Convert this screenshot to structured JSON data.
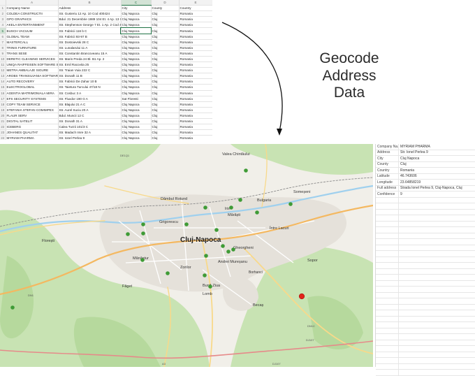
{
  "spreadsheet": {
    "column_letters": [
      "A",
      "B",
      "C",
      "D",
      "E"
    ],
    "headers": [
      "Company Name",
      "Address",
      "City",
      "County",
      "Country"
    ],
    "rows": [
      [
        "COLDEA CONSTRUCTII",
        "Str. Gusteriu 12 Ap. 10 Cod 400424",
        "Cluj Napoca",
        "Cluj",
        "Romania"
      ],
      [
        "GPO GRAPHICS",
        "Bdul. 21 Decembrie 1989 104 Et. 4 Ap. 13 Cod 400124",
        "Cluj Napoca",
        "Cluj",
        "Romania"
      ],
      [
        "AKELA ENTERTAINMENT",
        "Str. Stephenson George 7 Et. 1 Ap. 2 Cod 400287",
        "Cluj Napoca",
        "Cluj",
        "Romania"
      ],
      [
        "BUSCH VACUUM",
        "Str. Fabricii 116 b C",
        "Cluj Napoca",
        "Cluj",
        "Romania"
      ],
      [
        "GLOBAL TEAM",
        "Str. Fabricii 93-97 B",
        "Cluj Napoca",
        "Cluj",
        "Romania"
      ],
      [
        "MASTERCALL",
        "Str. Dostoievski 28 C",
        "Cluj Napoca",
        "Cluj",
        "Romania"
      ],
      [
        "TRINIS FURNITURE",
        "Str. Lunalarului 11 A",
        "Cluj Napoca",
        "Cluj",
        "Romania"
      ],
      [
        "TRANS SESE",
        "Str. Constantin Brancoveanu 15 A",
        "Cluj Napoca",
        "Cluj",
        "Romania"
      ],
      [
        "DERETIC CLEANING SERVICES",
        "Str. Marin Preda 24 Bl. B1 Ap. 2",
        "Cluj Napoca",
        "Cluj",
        "Romania"
      ],
      [
        "UNIQA RAIFFEISEN SOFTWARE SERVICE",
        "Str. Emil Racovita 25",
        "Cluj Napoca",
        "Cluj",
        "Romania"
      ],
      [
        "METRA AMBALAJE SIGURE",
        "Str. Traian Vuia 222 C",
        "Cluj Napoca",
        "Cluj",
        "Romania"
      ],
      [
        "AROBS TRANSILVANIA SOFTWARE SA",
        "Str. Donath 11 B",
        "Cluj Napoca",
        "Cluj",
        "Romania"
      ],
      [
        "AUTO RECOVERY",
        "Str. Fabricii De Zahar 10 B",
        "Cluj Napoca",
        "Cluj",
        "Romania"
      ],
      [
        "ELECTROGLOBAL",
        "Str. Taietura Turcului 47/18 N",
        "Cluj Napoca",
        "Cluj",
        "Romania"
      ],
      [
        "AGENTIA MATRIMONIALA MIRA",
        "Str. Cosbuc 3 A",
        "Cluj Napoca",
        "Cluj",
        "Romania"
      ],
      [
        "EFS SECURITY SYSTEMS",
        "Str. Fluxdor 190 G A",
        "Sat Floresti",
        "Cluj",
        "Romania"
      ],
      [
        "COPY TEAM SERVICE",
        "Str. Blajului 21 A C",
        "Cluj Napoca",
        "Cluj",
        "Romania"
      ],
      [
        "STEFANIA STEFAN COMIMPEX",
        "Str. Aurel Suciu 20 A",
        "Cluj Napoca",
        "Cluj",
        "Romania"
      ],
      [
        "FLAUR SERV",
        "Bdul. Muncii 12 C",
        "Cluj Napoca",
        "Cluj",
        "Romania"
      ],
      [
        "DIGITAL SATELIT",
        "Str. Donath 31 A",
        "Cluj Napoca",
        "Cluj",
        "Romania"
      ],
      [
        "ICEBERG",
        "Calea Turzii 101/3 C",
        "Cluj Napoca",
        "Cluj",
        "Romania"
      ],
      [
        "JOHANES QUALITAT",
        "Str. Madach Imre 32 A",
        "Cluj Napoca",
        "Cluj",
        "Romania"
      ],
      [
        "MYRIAM PHARMA",
        "Str. Ionel Perlea 9",
        "Cluj Napoca",
        "Cluj",
        "Romania"
      ],
      [
        "NEOSOFT",
        "Bdul. Constantin Brancusi 89 A",
        "Cluj Napoca",
        "Cluj",
        "Romania"
      ]
    ]
  },
  "caption": {
    "line1": "Geocode",
    "line2": "Address",
    "line3": "Data"
  },
  "map": {
    "place_labels": {
      "valea_chintaului": "Valea Chintăului",
      "gheorgheni_n": "Someșeni",
      "dambul_rotund": "Dâmbul Rotund",
      "iris": "Iris",
      "bulgaria": "Bulgaria",
      "grigorescu": "Grigorescu",
      "cluj_napoca": "Cluj-Napoca",
      "marasti": "Mărăști",
      "intre_lacuri": "Între Lacuri",
      "gheorgheni": "Gheorgheni",
      "manastur": "Mănăștur",
      "zorilor": "Zorilor",
      "andrei_muresanu": "Andrei Mureșanu",
      "borhanci": "Borhanci",
      "sopor": "Sopor",
      "buna_ziua": "Bună Ziua",
      "lomb": "Lomb",
      "faget": "Făget",
      "becas": "Becaș",
      "floresti": "Florești"
    },
    "road_labels": [
      "DE1Q1",
      "DN1",
      "A3",
      "DJ107",
      "DN1C",
      "DJ107"
    ],
    "pin_color": "#3f9b36",
    "selected_pin_color": "#e2231a",
    "green_area": "#c6e3b0",
    "urban_area": "#e6e2dc",
    "water_color": "#9fd0ee"
  },
  "info_panel": {
    "rows": [
      {
        "key": "Company Na...",
        "value": "MYRIAM PHARMA"
      },
      {
        "key": "Address",
        "value": "Str. Ionel Perlea 9"
      },
      {
        "key": "City",
        "value": "Cluj Napoca"
      },
      {
        "key": "County",
        "value": "Cluj"
      },
      {
        "key": "Country",
        "value": "Romania"
      },
      {
        "key": "Latitude",
        "value": "46.743606"
      },
      {
        "key": "Longitude",
        "value": "23.64858219"
      },
      {
        "key": "Full address",
        "value": "Strada Ionel Perlea 9, Cluj-Napoca, Cluj"
      },
      {
        "key": "Confidence",
        "value": "9"
      }
    ]
  }
}
